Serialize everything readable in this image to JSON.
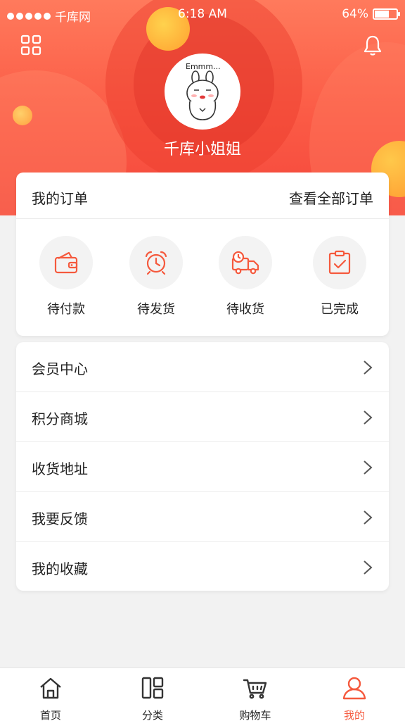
{
  "status_bar": {
    "carrier": "千库网",
    "time": "6:18 AM",
    "battery": "64%",
    "battery_level": 0.64
  },
  "header": {
    "avatar_caption": "Emmm...",
    "username": "千库小姐姐",
    "icons": [
      "grid-icon",
      "bell-icon"
    ]
  },
  "orders": {
    "title": "我的订单",
    "view_all": "查看全部订单",
    "items": [
      {
        "label": "待付款",
        "icon": "wallet-icon"
      },
      {
        "label": "待发货",
        "icon": "alarm-clock-icon"
      },
      {
        "label": "待收货",
        "icon": "delivery-truck-icon"
      },
      {
        "label": "已完成",
        "icon": "clipboard-check-icon"
      }
    ]
  },
  "menu": {
    "items": [
      {
        "label": "会员中心"
      },
      {
        "label": "积分商城"
      },
      {
        "label": "收货地址"
      },
      {
        "label": "我要反馈"
      },
      {
        "label": "我的收藏"
      }
    ]
  },
  "tab_bar": {
    "items": [
      {
        "label": "首页",
        "icon": "home-icon"
      },
      {
        "label": "分类",
        "icon": "category-icon"
      },
      {
        "label": "购物车",
        "icon": "cart-icon"
      },
      {
        "label": "我的",
        "icon": "user-icon",
        "active": true
      }
    ]
  },
  "colors": {
    "accent": "#f5593d",
    "header_top": "#ff7a5c",
    "header_bottom": "#f4473c",
    "background": "#f2f2f2"
  }
}
